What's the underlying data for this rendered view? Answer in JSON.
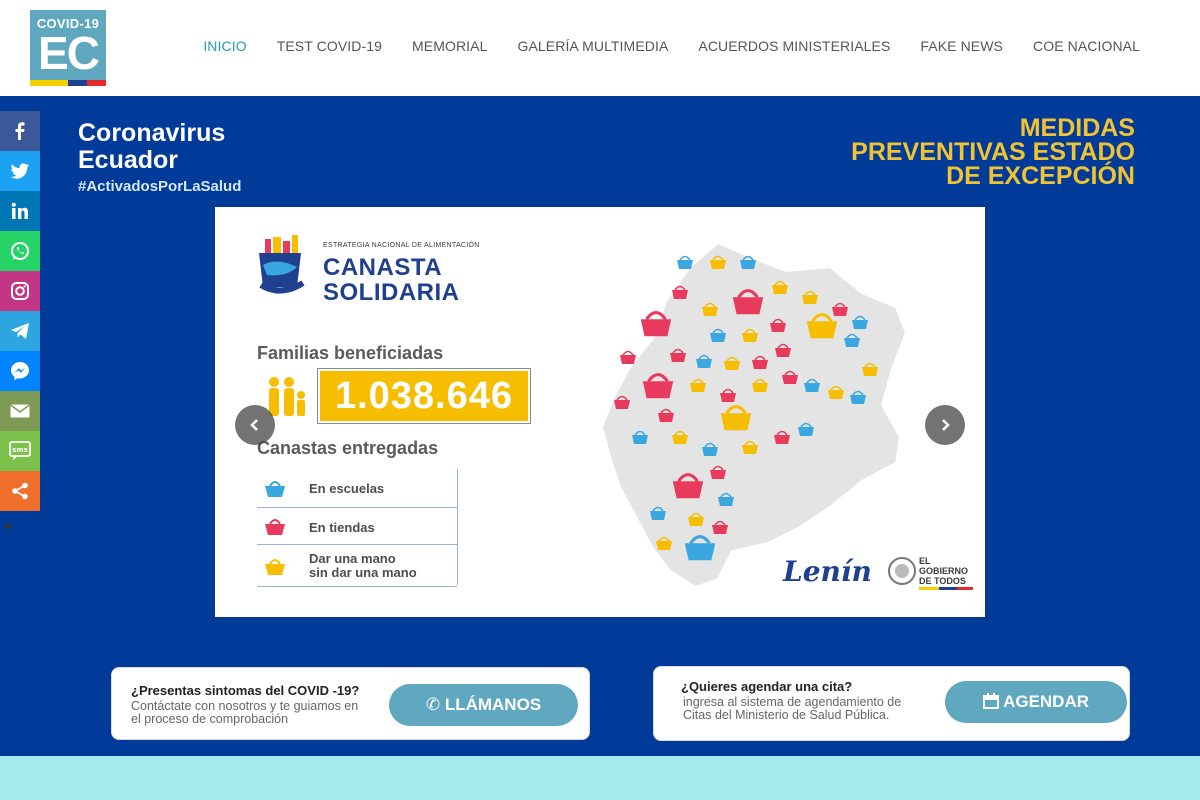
{
  "header": {
    "logo": {
      "top_text": "COVID-19",
      "main_text": "EC"
    },
    "nav": [
      {
        "label": "INICIO",
        "active": true
      },
      {
        "label": "TEST COVID-19",
        "active": false
      },
      {
        "label": "MEMORIAL",
        "active": false
      },
      {
        "label": "GALERÍA MULTIMEDIA",
        "active": false
      },
      {
        "label": "ACUERDOS MINISTERIALES",
        "active": false
      },
      {
        "label": "FAKE NEWS",
        "active": false
      },
      {
        "label": "COE NACIONAL",
        "active": false
      }
    ]
  },
  "hero": {
    "title_line1": "Coronavirus",
    "title_line2": "Ecuador",
    "hashtag": "#ActivadosPorLaSalud",
    "medidas_line1": "MEDIDAS",
    "medidas_line2": "PREVENTIVAS ESTADO",
    "medidas_line3": "DE EXCEPCIÓN"
  },
  "slide": {
    "brand_small": "ESTRATEGIA NACIONAL DE ALIMENTACIÓN",
    "brand_big_line1": "CANASTA",
    "brand_big_line2": "SOLIDARIA",
    "families_label": "Familias beneficiadas",
    "families_count": "1.038.646",
    "baskets_label": "Canastas entregadas",
    "legend": [
      {
        "label": "En escuelas",
        "color": "#3aa7e0"
      },
      {
        "label": "En tiendas",
        "color": "#e83a5c"
      },
      {
        "label_line1": "Dar una mano",
        "label_line2": "sin dar una mano",
        "color": "#f7bd00"
      }
    ],
    "signature": "Lenín",
    "gov_line1": "EL",
    "gov_line2": "GOBIERNO",
    "gov_line3": "DE TODOS"
  },
  "slider_controls": {
    "prev_icon": "chevron-left-icon",
    "next_icon": "chevron-right-icon"
  },
  "cta": {
    "call": {
      "question": "¿Presentas sintomas del COVID -19?",
      "subtitle_line1": "Contáctate con nosotros y te guiamos en",
      "subtitle_line2": "el proceso de comprobación",
      "button": "LLÁMANOS",
      "icon": "phone-icon"
    },
    "schedule": {
      "question": "¿Quieres agendar una cita?",
      "subtitle_line1": "ingresa al sistema de agendamiento de",
      "subtitle_line2": "Citas del Ministerio de Salud Pública.",
      "button": "AGENDAR",
      "icon": "calendar-icon"
    }
  },
  "social": [
    {
      "name": "facebook-icon",
      "color": "#3b5998"
    },
    {
      "name": "twitter-icon",
      "color": "#1da1f2"
    },
    {
      "name": "linkedin-icon",
      "color": "#0077b5"
    },
    {
      "name": "whatsapp-icon",
      "color": "#25d366"
    },
    {
      "name": "instagram-icon",
      "color": "#c13584"
    },
    {
      "name": "telegram-icon",
      "color": "#2ca5e0"
    },
    {
      "name": "messenger-icon",
      "color": "#0084ff"
    },
    {
      "name": "email-icon",
      "color": "#7d9a55"
    },
    {
      "name": "sms-icon",
      "color": "#7bc14b"
    },
    {
      "name": "share-icon",
      "color": "#f0702b"
    }
  ],
  "colors": {
    "nav_active": "#2a9bb0",
    "hero_bg": "#003b9a",
    "medidas": "#f1c232",
    "button": "#5fa8c0",
    "bottom_band": "#a6ebec"
  }
}
